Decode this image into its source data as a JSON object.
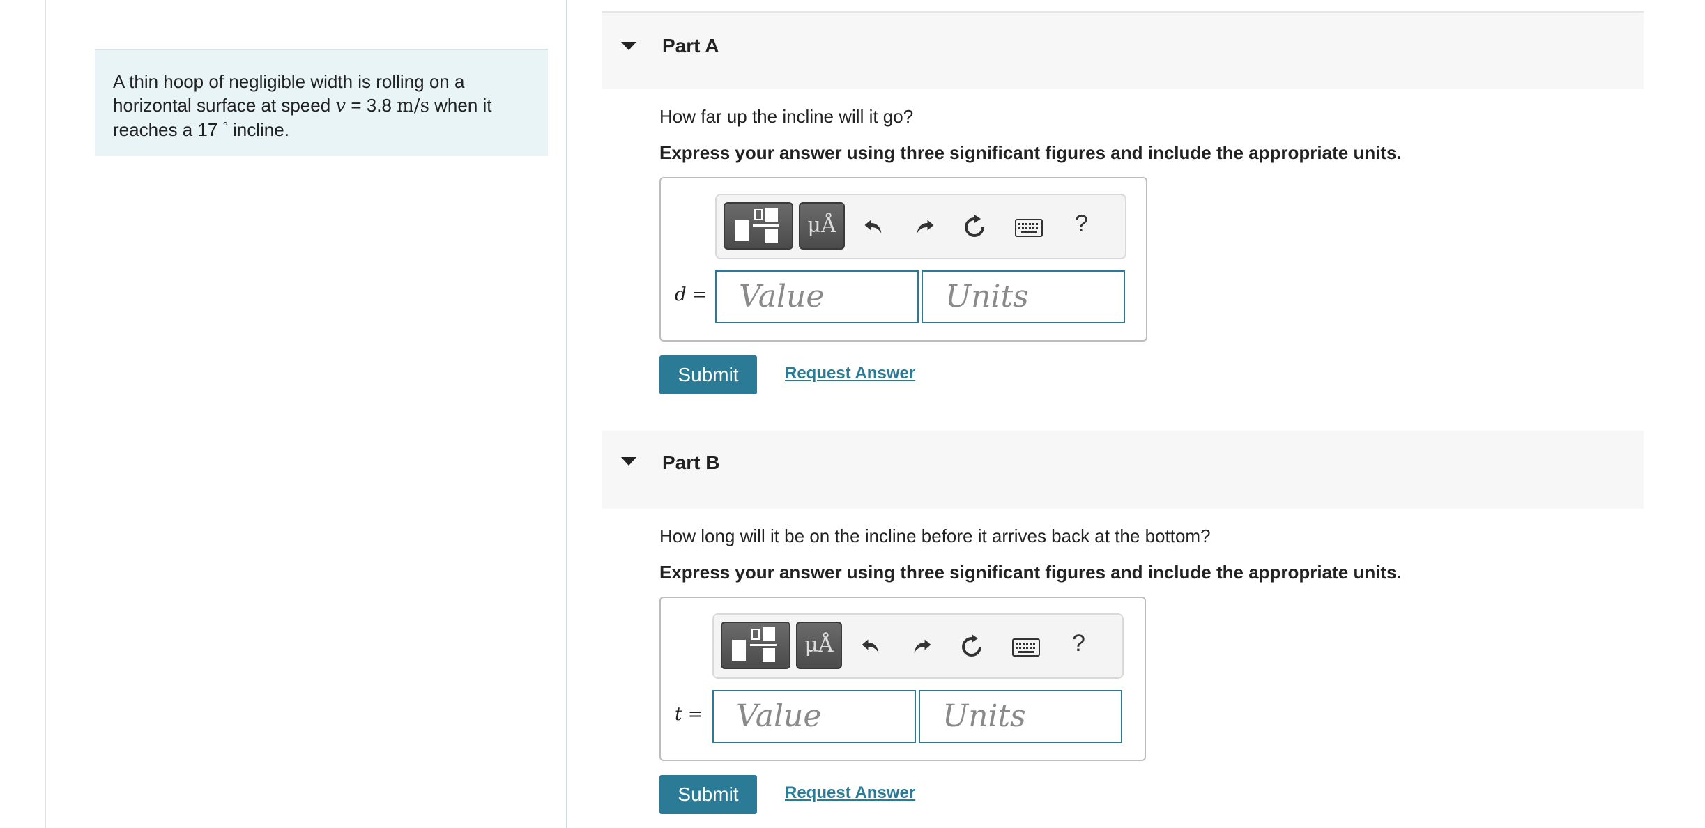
{
  "problem": {
    "text_before": "A thin hoop of negligible width is rolling on a horizontal surface at speed ",
    "speed_symbol": "v",
    "speed_value": "= 3.8",
    "speed_units": "m/s",
    "text_middle": " when it reaches a 17 ",
    "degree": "°",
    "text_after": " incline."
  },
  "parts": [
    {
      "title": "Part A",
      "question": "How far up the incline will it go?",
      "instruction": "Express your answer using three significant figures and include the appropriate units.",
      "variable": "d",
      "equals": "=",
      "value_placeholder": "Value",
      "units_placeholder": "Units",
      "symbols_label": "μÅ",
      "help_label": "?",
      "submit_label": "Submit",
      "request_label": "Request Answer"
    },
    {
      "title": "Part B",
      "question": "How long will it be on the incline before it arrives back at the bottom?",
      "instruction": "Express your answer using three significant figures and include the appropriate units.",
      "variable": "t",
      "equals": "=",
      "value_placeholder": "Value",
      "units_placeholder": "Units",
      "symbols_label": "μÅ",
      "help_label": "?",
      "submit_label": "Submit",
      "request_label": "Request Answer"
    }
  ],
  "icons": {
    "collapse": "caret-down-icon",
    "templates": "templates-icon",
    "undo": "undo-icon",
    "redo": "redo-icon",
    "reset": "reset-icon",
    "keyboard": "keyboard-icon",
    "help": "help-icon"
  },
  "colors": {
    "accent": "#2b7a96",
    "problem_bg": "#e8f4f6",
    "header_bg": "#f7f7f7"
  }
}
